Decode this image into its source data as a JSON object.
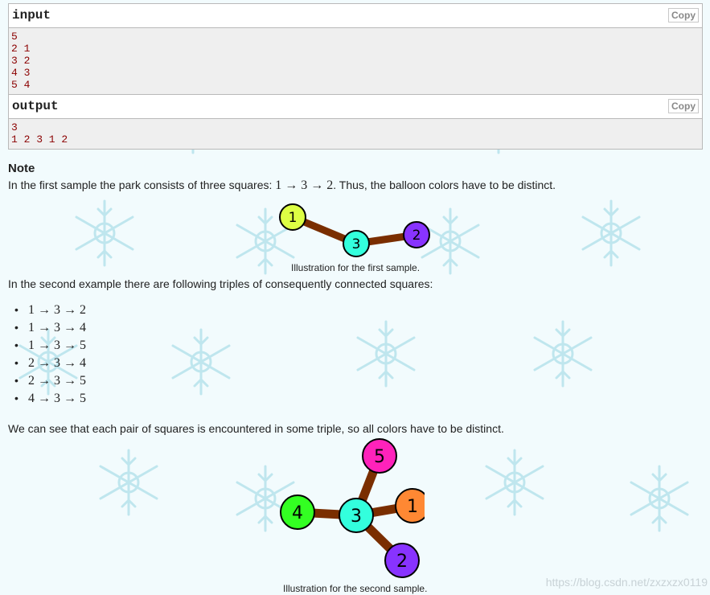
{
  "input_block": {
    "label": "input",
    "copy_label": "Copy",
    "lines": [
      "5",
      "2 1",
      "3 2",
      "4 3",
      "5 4"
    ]
  },
  "output_block": {
    "label": "output",
    "copy_label": "Copy",
    "lines": [
      "3",
      "1 2 3 1 2"
    ]
  },
  "note": {
    "title": "Note",
    "para1_prefix": "In the first sample the park consists of three squares: ",
    "para1_math": "1 → 3 → 2",
    "para1_suffix": ". Thus, the balloon colors have to be distinct.",
    "caption1": "Illustration for the first sample.",
    "para2": "In the second example there are following triples of consequently connected squares:",
    "triples": [
      "1 → 3 → 2",
      "1 → 3 → 4",
      "1 → 3 → 5",
      "2 → 3 → 4",
      "2 → 3 → 5",
      "4 → 3 → 5"
    ],
    "para3": "We can see that each pair of squares is encountered in some triple, so all colors have to be distinct.",
    "caption2": "Illustration for the second sample."
  },
  "figure1": {
    "nodes": [
      {
        "label": "1",
        "color": "#ddff44"
      },
      {
        "label": "3",
        "color": "#33ffdd"
      },
      {
        "label": "2",
        "color": "#8833ff"
      }
    ],
    "edge_color": "#7a2e00"
  },
  "figure2": {
    "nodes": [
      {
        "label": "5",
        "color": "#ff22bb"
      },
      {
        "label": "1",
        "color": "#ff8833"
      },
      {
        "label": "4",
        "color": "#33ff22"
      },
      {
        "label": "3",
        "color": "#33ffdd"
      },
      {
        "label": "2",
        "color": "#8833ff"
      }
    ],
    "edge_color": "#7a2e00"
  },
  "watermark": "https://blog.csdn.net/zxzxzx0119"
}
